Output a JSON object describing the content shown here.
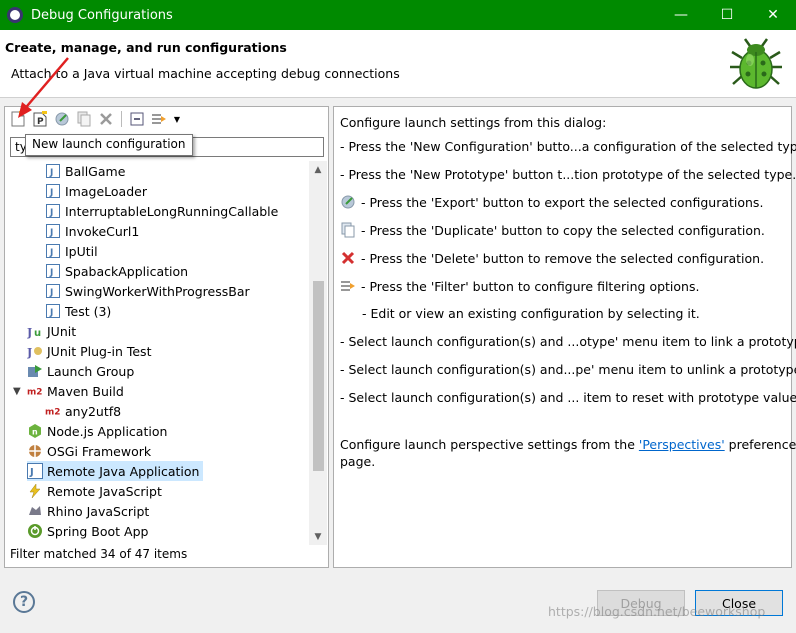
{
  "window": {
    "title": "Debug Configurations",
    "controls": [
      "—",
      "☐",
      "✕"
    ]
  },
  "header": {
    "title": "Create, manage, and run configurations",
    "subtitle": "Attach to a Java virtual machine accepting debug connections"
  },
  "left": {
    "tooltip": "New launch configuration",
    "filter_value": "ty",
    "status": "Filter matched 34 of 47 items",
    "items": [
      {
        "label": "BallGame",
        "icon": "java-class-icon",
        "indent": 2
      },
      {
        "label": "ImageLoader",
        "icon": "java-class-icon",
        "indent": 2
      },
      {
        "label": "InterruptableLongRunningCallable",
        "icon": "java-class-icon",
        "indent": 2
      },
      {
        "label": "InvokeCurl1",
        "icon": "java-class-icon",
        "indent": 2
      },
      {
        "label": "IpUtil",
        "icon": "java-class-icon",
        "indent": 2
      },
      {
        "label": "SpabackApplication",
        "icon": "java-class-icon",
        "indent": 2
      },
      {
        "label": "SwingWorkerWithProgressBar",
        "icon": "java-class-icon",
        "indent": 2
      },
      {
        "label": "Test (3)",
        "icon": "java-class-icon",
        "indent": 2
      },
      {
        "label": "JUnit",
        "icon": "junit-icon",
        "indent": 1
      },
      {
        "label": "JUnit Plug-in Test",
        "icon": "junit-plugin-icon",
        "indent": 1
      },
      {
        "label": "Launch Group",
        "icon": "launch-group-icon",
        "indent": 1
      },
      {
        "label": "Maven Build",
        "icon": "maven-icon",
        "indent": 1,
        "expanded": true
      },
      {
        "label": "any2utf8",
        "icon": "maven-icon",
        "indent": 2
      },
      {
        "label": "Node.js Application",
        "icon": "nodejs-icon",
        "indent": 1
      },
      {
        "label": "OSGi Framework",
        "icon": "osgi-icon",
        "indent": 1
      },
      {
        "label": "Remote Java Application",
        "icon": "remote-java-icon",
        "indent": 1,
        "selected": true
      },
      {
        "label": "Remote JavaScript",
        "icon": "remote-js-icon",
        "indent": 1
      },
      {
        "label": "Rhino JavaScript",
        "icon": "rhino-icon",
        "indent": 1
      },
      {
        "label": "Spring Boot App",
        "icon": "spring-boot-icon",
        "indent": 1
      }
    ]
  },
  "right": {
    "intro": "Configure launch settings from this dialog:",
    "lines": [
      "- Press the 'New Configuration' butto...a configuration of the selected type.",
      "- Press the 'New Prototype' button t...tion prototype of the selected type.",
      "- Press the 'Export' button to export the selected configurations.",
      "- Press the 'Duplicate' button to copy the selected configuration.",
      "- Press the 'Delete' button to remove the selected configuration.",
      "- Press the 'Filter' button to configure filtering options.",
      "- Edit or view an existing configuration by selecting it.",
      "- Select launch configuration(s) and ...otype' menu item to link a prototype.",
      "- Select launch configuration(s) and...pe' menu item to unlink a prototype.",
      "- Select launch configuration(s) and ... item to reset with prototype values."
    ],
    "perspective_prefix": "Configure launch perspective settings from the ",
    "perspective_link": "'Perspectives'",
    "perspective_suffix": " preference",
    "perspective_line2": "page."
  },
  "buttons": {
    "help": "?",
    "debug": "Debug",
    "close": "Close"
  },
  "watermark": "https://blog.csdn.net/beeworkshop",
  "colors": {
    "titlebar": "#008a00",
    "selection": "#cce8ff",
    "link": "#0066cc"
  }
}
